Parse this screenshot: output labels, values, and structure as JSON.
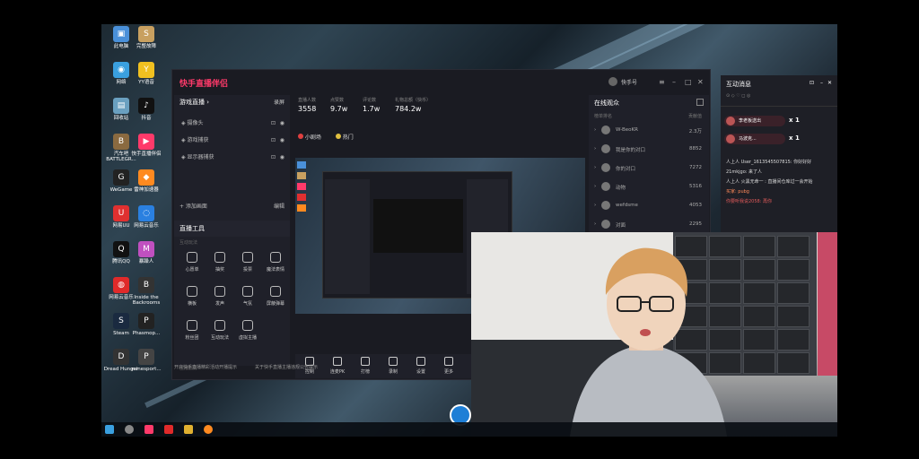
{
  "desktop": {
    "icons": [
      {
        "label": "此电脑",
        "color": "#4a90d9",
        "glyph": "▣"
      },
      {
        "label": "完整故障",
        "color": "#c8a060",
        "glyph": "S"
      },
      {
        "label": "网络",
        "color": "#3aa0e0",
        "glyph": "◉"
      },
      {
        "label": "YY语音",
        "color": "#f0c020",
        "glyph": "Y"
      },
      {
        "label": "回收站",
        "color": "#6aa0c0",
        "glyph": "▤"
      },
      {
        "label": "抖音",
        "color": "#111111",
        "glyph": "♪"
      },
      {
        "label": "汽车吧 BATTLEGR...",
        "color": "#8a6a40",
        "glyph": "B"
      },
      {
        "label": "快手直播伴侣",
        "color": "#ff3a6a",
        "glyph": "▶"
      },
      {
        "label": "WeGame",
        "color": "#222222",
        "glyph": "G"
      },
      {
        "label": "雷神加速器",
        "color": "#ff8a20",
        "glyph": "◆"
      },
      {
        "label": "网易UU",
        "color": "#e03030",
        "glyph": "U"
      },
      {
        "label": "网易云音乐",
        "color": "#2a80e0",
        "glyph": "◌"
      },
      {
        "label": "腾讯QQ",
        "color": "#111111",
        "glyph": "Q"
      },
      {
        "label": "暴躁人",
        "color": "#c050c0",
        "glyph": "M"
      },
      {
        "label": "网易云音乐",
        "color": "#e02a2a",
        "glyph": "◍"
      },
      {
        "label": "Inside the Backrooms",
        "color": "#333333",
        "glyph": "B"
      },
      {
        "label": "Steam",
        "color": "#1a2a40",
        "glyph": "S"
      },
      {
        "label": "Phasmop...",
        "color": "#222222",
        "glyph": "P"
      },
      {
        "label": "Dread Hunger",
        "color": "#333333",
        "glyph": "D"
      },
      {
        "label": "minesport...",
        "color": "#444444",
        "glyph": "P"
      }
    ]
  },
  "app": {
    "title": "快手直播伴侣",
    "user": "快手号",
    "left_panel": {
      "header": "游戏直播 ›",
      "header_action": "录屏",
      "sources": [
        "摄像头",
        "游戏捕获",
        "显示器捕获"
      ],
      "add_source": "+ 添加画面",
      "add_action": "编辑"
    },
    "tools": {
      "header": "直播工具",
      "sub": "互动玩法",
      "items": [
        "心愿单",
        "抽奖",
        "投票",
        "魔法表情",
        "横板",
        "发声",
        "气氛",
        "屏蔽弹幕",
        "粉丝团",
        "互动玩法",
        "虚拟主播"
      ],
      "footer": "主播服务"
    },
    "stats": [
      {
        "label": "直播人数",
        "value": "3558"
      },
      {
        "label": "点赞数",
        "value": "9.7w"
      },
      {
        "label": "评论数",
        "value": "1.7w"
      },
      {
        "label": "礼物总额（快币）",
        "value": "784.2w"
      }
    ],
    "tags": [
      "小剧场",
      "热门"
    ],
    "bottom_bar": [
      "控制",
      "连麦PK",
      "打榜",
      "录制",
      "设置",
      "更多"
    ],
    "notices": [
      "开启快手直播精彩活动开播提示",
      "关于快手直播主播违规公告提示"
    ],
    "audience": {
      "header": "在线观众",
      "subheader": "榜单排名",
      "right": "贡献值",
      "rows": [
        {
          "name": "W-BeoKR",
          "score": "2.3万"
        },
        {
          "name": "我是你的对口",
          "score": "8852"
        },
        {
          "name": "你的对口",
          "score": "7272"
        },
        {
          "name": "动物",
          "score": "5316"
        },
        {
          "name": "wefdsme",
          "score": "4053"
        },
        {
          "name": "对面",
          "score": "2295"
        }
      ]
    }
  },
  "chat": {
    "title": "互动消息",
    "gifts": [
      {
        "name": "李老板送出",
        "count": "x 1"
      },
      {
        "name": "马波克...",
        "count": "x 1"
      }
    ],
    "lines": [
      "人上人 User_1613545507815: 你好好好",
      "21mkjgo: 来了人",
      "人上人 火黑无命一 : 直播间仓库过一会开始",
      "买家: pubg",
      "你要听我说2058: 再你"
    ]
  }
}
